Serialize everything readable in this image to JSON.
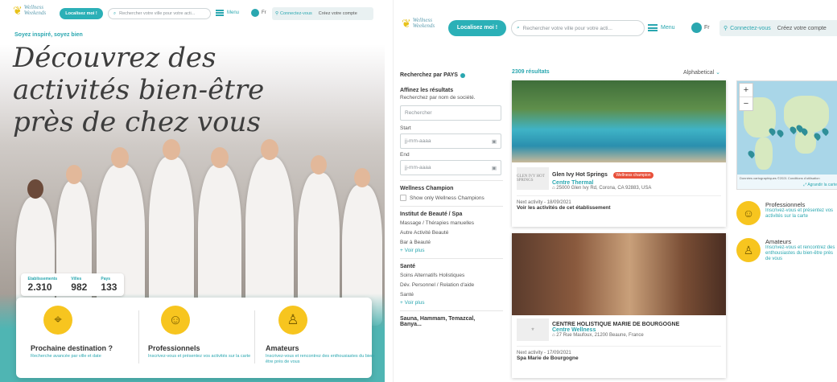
{
  "left": {
    "logo": {
      "line1": "Wellness",
      "line2": "Weekends"
    },
    "locate_btn": "Localisez moi !",
    "search_placeholder": "Rechercher votre ville pour votre acti...",
    "menu_label": "Menu",
    "lang": "Fr",
    "login": "Connectez-vous",
    "create": "Créez votre compte",
    "tagline": "Soyez inspiré, soyez bien",
    "hero_title": "Découvrez des activités bien-être près de chez vous",
    "stats": [
      {
        "label": "Etablissements",
        "value": "2.310"
      },
      {
        "label": "Villes",
        "value": "982"
      },
      {
        "label": "Pays",
        "value": "133"
      }
    ],
    "cards": [
      {
        "title": "Prochaine destination ?",
        "sub": "Recherche avancée par ville et date"
      },
      {
        "title": "Professionnels",
        "sub": "Inscrivez-vous et présentez vos activités sur la carte"
      },
      {
        "title": "Amateurs",
        "sub": "Inscrivez-vous et rencontrez des enthousiastes du bien-être près de vous"
      }
    ]
  },
  "right": {
    "logo": {
      "line1": "Wellness",
      "line2": "Weekends"
    },
    "locate_btn": "Localisez moi !",
    "search_placeholder": "Rechercher votre ville pour votre acti...",
    "menu_label": "Menu",
    "lang": "Fr",
    "login": "Connectez-vous",
    "create": "Créez votre compte",
    "filters": {
      "country_label": "Recherchez par PAYS",
      "refine_title": "Affinez les résultats",
      "company_label": "Recherchez par nom de société.",
      "company_placeholder": "Rechercher",
      "start_label": "Start",
      "start_placeholder": "jj-mm-aaaa",
      "end_label": "End",
      "end_placeholder": "jj-mm-aaaa",
      "champion_title": "Wellness Champion",
      "champion_check": "Show only Wellness Champions",
      "beauty_title": "Institut de Beauté / Spa",
      "beauty_items": [
        "Massage / Thérapies manuelles",
        "Autre Activité Beauté",
        "Bar à Beauté"
      ],
      "more1": "+ Voir plus",
      "health_title": "Santé",
      "health_items": [
        "Soins Alternatifs Holistiques",
        "Dév. Personnel / Relation d'aide",
        "Santé"
      ],
      "more2": "+ Voir plus",
      "sauna_title": "Sauna, Hammam, Temazcal, Banya..."
    },
    "results_count": "2309 résultats",
    "sort_label": "Alphabetical",
    "results": [
      {
        "name": "Glen Ivy Hot Springs",
        "badge": "Wellness champion",
        "thumb_text": "GLEN IVY HOT SPRINGS",
        "category": "Centre Thermal",
        "address": "25000 Glen Ivy Rd, Corona, CA 92883, USA",
        "next": "Next activity - 18/09/2021",
        "link": "Voir les activités de cet établissement"
      },
      {
        "name": "CENTRE HOLISTIQUE MARIE DE BOURGOGNE",
        "category": "Centre Wellness",
        "address": "27 Rue Maufoux, 21200 Beaune, France",
        "next": "Next activity - 17/09/2021",
        "link": "Spa Marie de Bourgogne"
      }
    ],
    "map": {
      "zoom_in": "+",
      "zoom_out": "−",
      "attribution": "Données cartographiques ©2021   Conditions d'utilisation",
      "enlarge": "Agrandir la carte"
    },
    "aside": [
      {
        "title": "Professionnels",
        "sub": "Inscrivez-vous et présentez vos activités sur la carte"
      },
      {
        "title": "Amateurs",
        "sub": "Inscrivez-vous et rencontrez des enthousiastes du bien-être près de vous"
      }
    ]
  }
}
